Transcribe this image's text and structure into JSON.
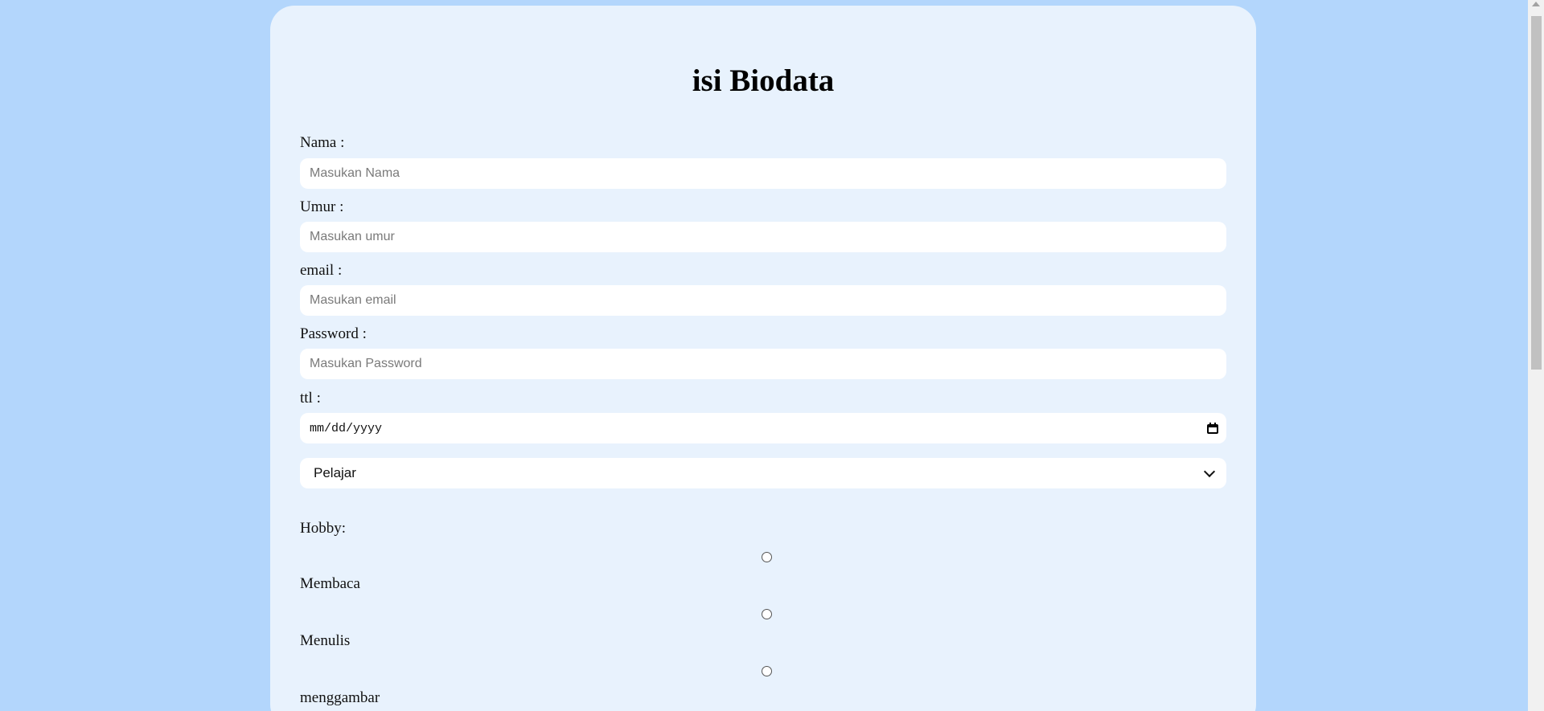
{
  "page": {
    "title": "isi Biodata"
  },
  "form": {
    "nama": {
      "label": "Nama :",
      "placeholder": "Masukan Nama"
    },
    "umur": {
      "label": "Umur :",
      "placeholder": "Masukan umur"
    },
    "email": {
      "label": "email :",
      "placeholder": "Masukan email"
    },
    "password": {
      "label": "Password :",
      "placeholder": "Masukan Password"
    },
    "ttl": {
      "label": "ttl :",
      "value": "mm/dd/yyyy"
    },
    "status": {
      "selected": "Pelajar"
    },
    "hobby": {
      "label": "Hobby:",
      "options": [
        "Membaca",
        "Menulis",
        "menggambar"
      ]
    }
  },
  "colors": {
    "background": "#b3d6fc",
    "card": "#e8f2fd",
    "field": "#ffffff"
  },
  "icons": {
    "date": "calendar-icon",
    "select": "chevron-down-icon",
    "radio": "radio-button"
  }
}
